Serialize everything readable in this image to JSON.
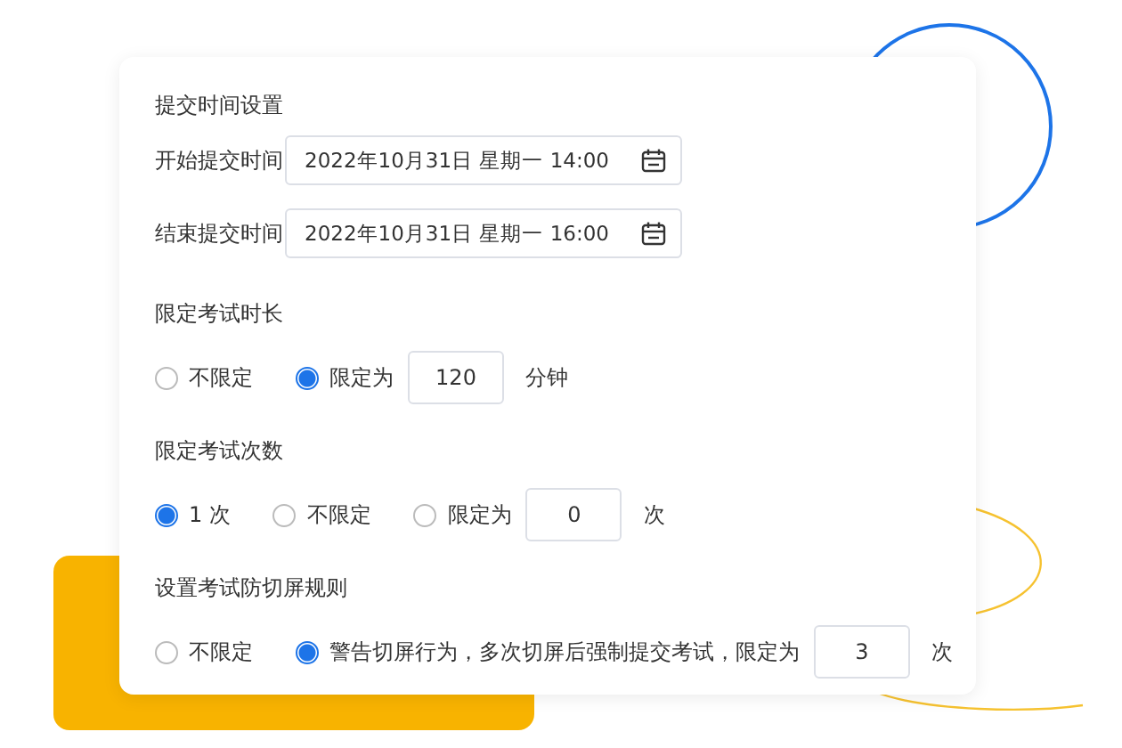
{
  "sections": [
    {
      "kind": "datetime",
      "title": "提交时间设置",
      "fields": [
        {
          "label": "开始提交时间",
          "value": "2022年10月31日 星期一 14:00"
        },
        {
          "label": "结束提交时间",
          "value": "2022年10月31日 星期一 16:00"
        }
      ]
    },
    {
      "kind": "radio",
      "title": "限定考试时长",
      "options": [
        {
          "label": "不限定",
          "selected": false
        },
        {
          "label": "限定为",
          "selected": true,
          "value": "120",
          "suffix": "分钟"
        }
      ]
    },
    {
      "kind": "radio",
      "title": "限定考试次数",
      "options": [
        {
          "label": "1 次",
          "selected": true
        },
        {
          "label": "不限定",
          "selected": false
        },
        {
          "label": "限定为",
          "selected": false,
          "value": "0",
          "suffix": "次"
        }
      ]
    },
    {
      "kind": "radio",
      "title": "设置考试防切屏规则",
      "options": [
        {
          "label": "不限定",
          "selected": false
        },
        {
          "label": "警告切屏行为，多次切屏后强制提交考试，限定为",
          "selected": true,
          "value": "3",
          "suffix": "次"
        }
      ]
    }
  ]
}
